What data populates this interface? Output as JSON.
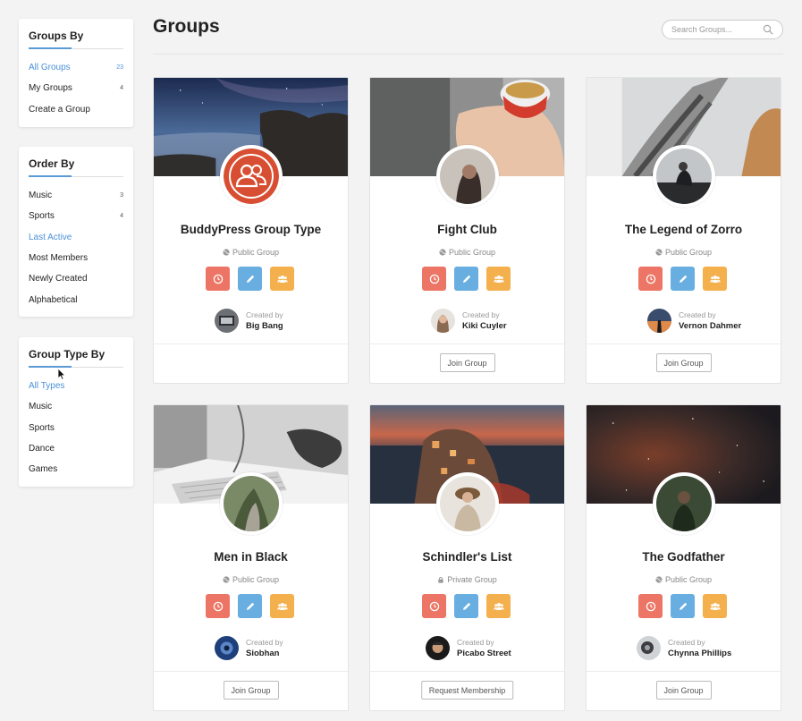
{
  "sidebar": {
    "groups_by": {
      "title": "Groups By",
      "items": [
        {
          "label": "All Groups",
          "count": "23",
          "active": true
        },
        {
          "label": "My Groups",
          "count": "4",
          "active": false
        },
        {
          "label": "Create a Group",
          "count": "",
          "active": false
        }
      ]
    },
    "order_by": {
      "title": "Order By",
      "items": [
        {
          "label": "Music",
          "count": "3",
          "active": false
        },
        {
          "label": "Sports",
          "count": "4",
          "active": false
        },
        {
          "label": "Last Active",
          "count": "",
          "active": true
        },
        {
          "label": "Most Members",
          "count": "",
          "active": false
        },
        {
          "label": "Newly Created",
          "count": "",
          "active": false
        },
        {
          "label": "Alphabetical",
          "count": "",
          "active": false
        }
      ]
    },
    "group_type_by": {
      "title": "Group Type By",
      "items": [
        {
          "label": "All Types",
          "active": true
        },
        {
          "label": "Music",
          "active": false
        },
        {
          "label": "Sports",
          "active": false
        },
        {
          "label": "Dance",
          "active": false
        },
        {
          "label": "Games",
          "active": false
        }
      ]
    }
  },
  "header": {
    "title": "Groups",
    "search_placeholder": "Search Groups..."
  },
  "colors": {
    "accent": "#4a90d9",
    "action_red": "#ec7565",
    "action_blue": "#68aee0",
    "action_orange": "#f4b04d"
  },
  "card_labels": {
    "created_by": "Created by"
  },
  "groups": [
    {
      "name": "BuddyPress Group Type",
      "status": "Public Group",
      "status_icon": "globe-icon",
      "creator": "Big Bang",
      "button": ""
    },
    {
      "name": "Fight Club",
      "status": "Public Group",
      "status_icon": "globe-icon",
      "creator": "Kiki Cuyler",
      "button": "Join Group"
    },
    {
      "name": "The Legend of Zorro",
      "status": "Public Group",
      "status_icon": "globe-icon",
      "creator": "Vernon Dahmer",
      "button": "Join Group"
    },
    {
      "name": "Men in Black",
      "status": "Public Group",
      "status_icon": "globe-icon",
      "creator": "Siobhan",
      "button": "Join Group"
    },
    {
      "name": "Schindler's List",
      "status": "Private Group",
      "status_icon": "lock-icon",
      "creator": "Picabo Street",
      "button": "Request Membership"
    },
    {
      "name": "The Godfather",
      "status": "Public Group",
      "status_icon": "globe-icon",
      "creator": "Chynna Phillips",
      "button": "Join Group"
    }
  ]
}
